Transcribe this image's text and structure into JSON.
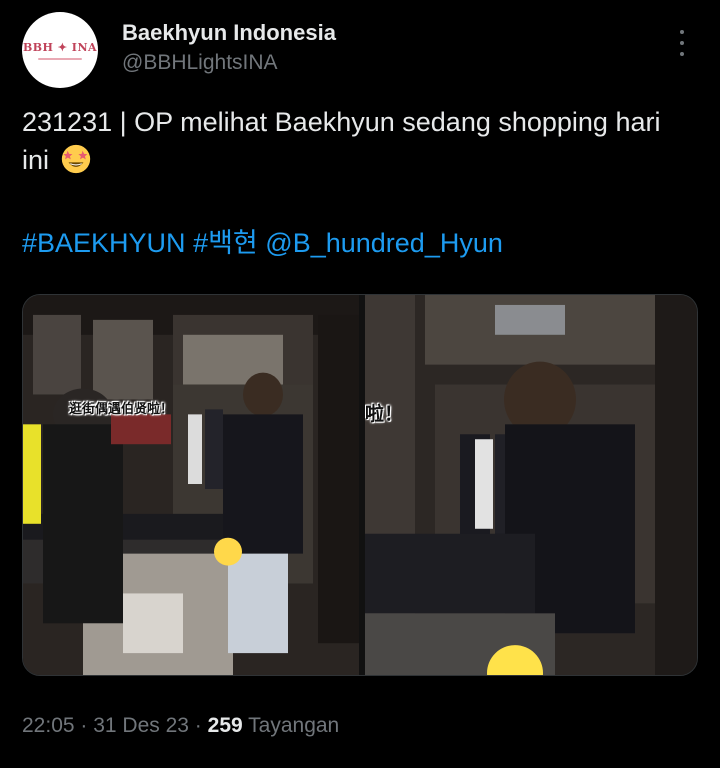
{
  "author": {
    "display_name": "Baekhyun Indonesia",
    "handle": "@BBHLightsINA",
    "avatar_text": "BBH ✦ INA",
    "avatar_icon": "profile-logo"
  },
  "more_icon": "more-vertical-icon",
  "tweet": {
    "text": "231231 | OP melihat Baekhyun sedang shopping hari ini",
    "emoji": "star-struck-emoji",
    "hashtags": [
      "#BAEKHYUN",
      "#백현"
    ],
    "mention": "@B_hundred_Hyun"
  },
  "media": {
    "photos": [
      {
        "caption": "逛街偶遇伯贤啦！"
      },
      {
        "caption": "啦！"
      }
    ]
  },
  "meta": {
    "time": "22:05",
    "separator": " · ",
    "date": "31 Des 23",
    "views_count": "259",
    "views_label": "Tayangan"
  },
  "colors": {
    "background": "#000000",
    "text": "#e7e9ea",
    "secondary": "#71767b",
    "link": "#1d9bf0"
  }
}
